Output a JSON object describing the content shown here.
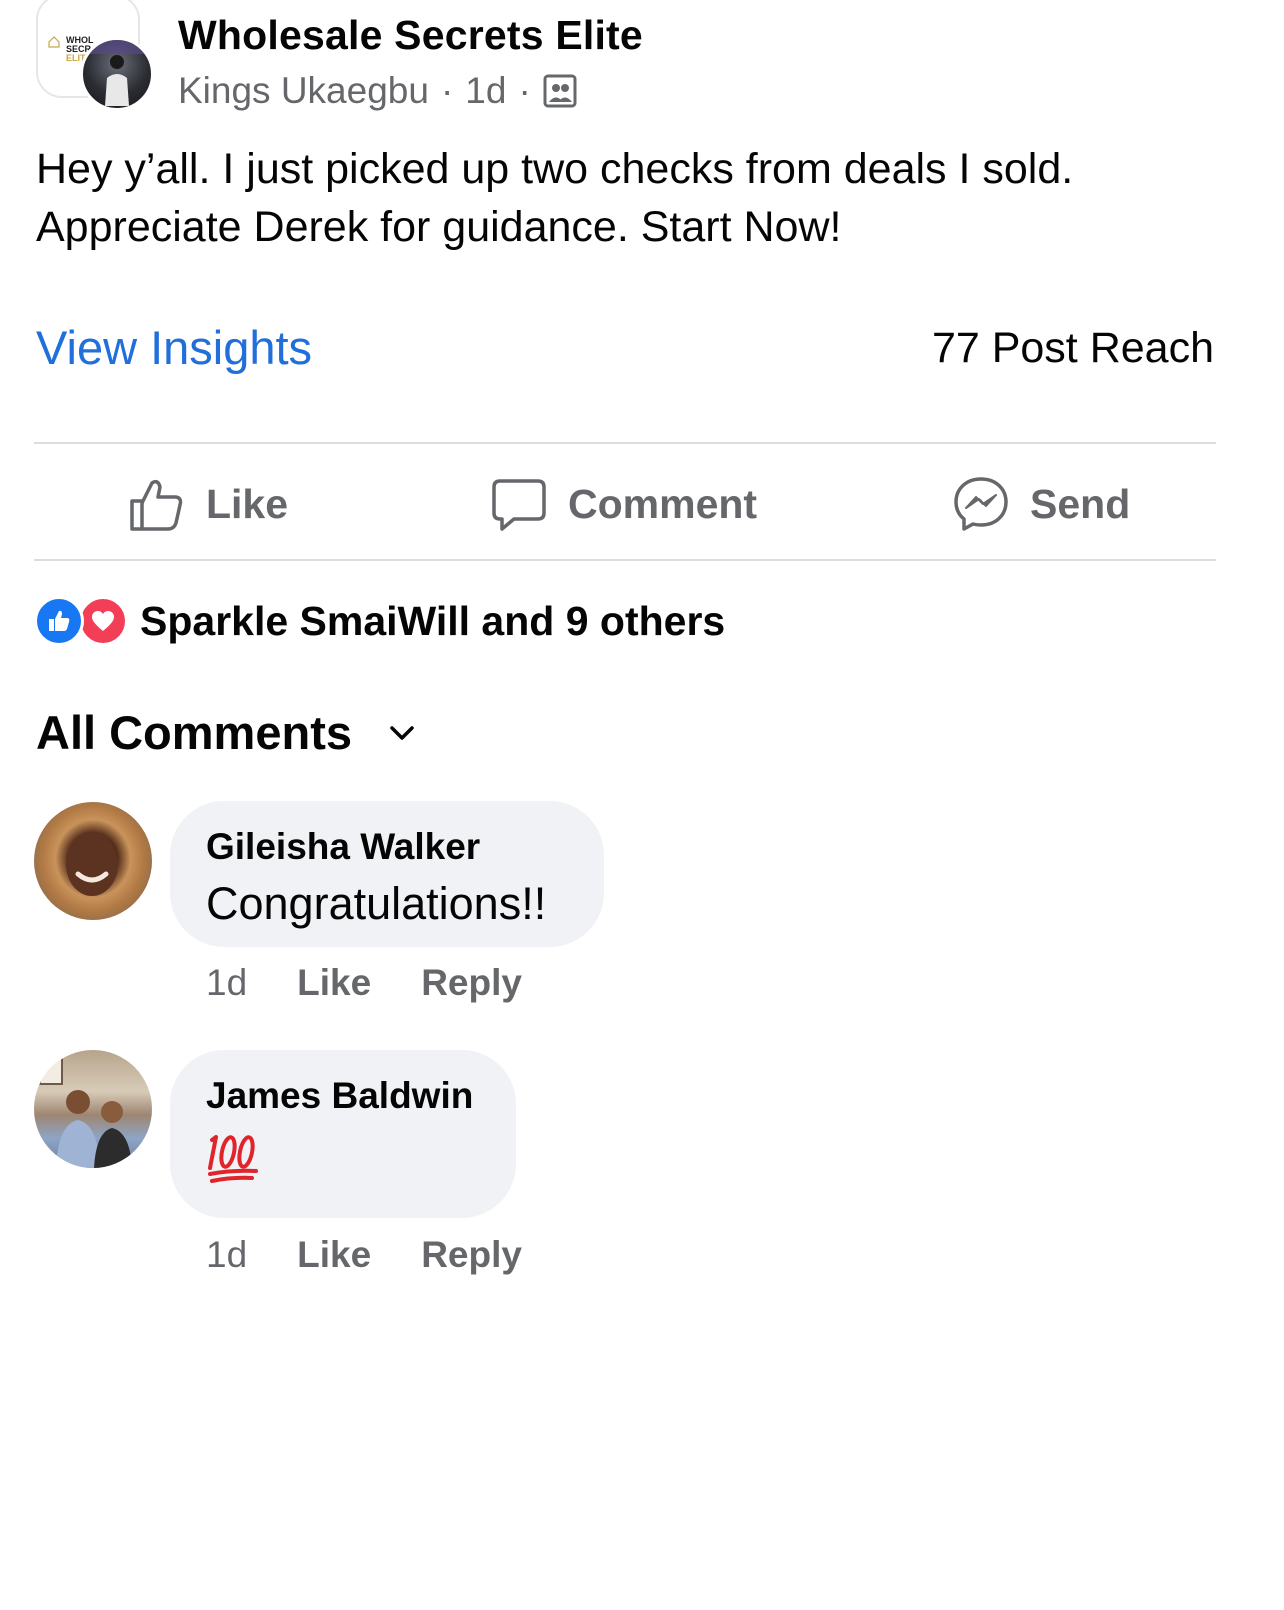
{
  "post": {
    "group_name": "Wholesale Secrets Elite",
    "author": "Kings Ukaegbu",
    "separator": "·",
    "time": "1d",
    "audience_icon": "group-icon",
    "group_logo_text": [
      "WHOL",
      "SECR",
      "ELIT"
    ],
    "body": "Hey y’all. I just picked up two checks from deals I sold. Appreciate Derek for guidance. Start Now!"
  },
  "insights": {
    "link_label": "View Insights",
    "reach_label": "77 Post Reach"
  },
  "actions": {
    "like_label": "Like",
    "comment_label": "Comment",
    "send_label": "Send"
  },
  "reactions": {
    "types": [
      "like",
      "love"
    ],
    "summary": "Sparkle SmaiWill and 9 others"
  },
  "comments_section": {
    "filter_label": "All Comments"
  },
  "comments": [
    {
      "author": "Gileisha Walker",
      "text": "Congratulations!!",
      "time": "1d",
      "like_label": "Like",
      "reply_label": "Reply"
    },
    {
      "author": "James Baldwin",
      "emoji": "hundred-points-emoji",
      "time": "1d",
      "like_label": "Like",
      "reply_label": "Reply"
    }
  ],
  "colors": {
    "link_blue": "#216fdb",
    "secondary_text": "#65676b",
    "bubble_bg": "#f0f2f5",
    "like_blue": "#1877f2",
    "love_red": "#f33e58"
  }
}
